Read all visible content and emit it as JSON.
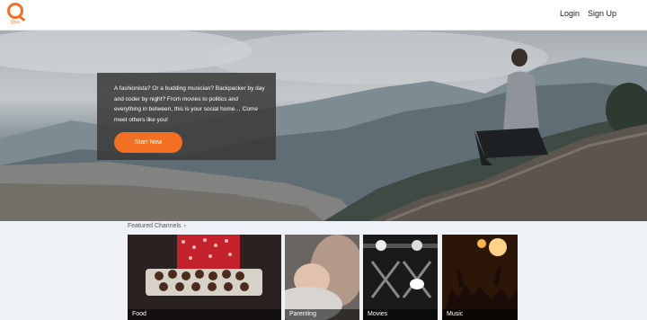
{
  "brand": {
    "logo_text": "Quu",
    "accent_color": "#f36f21"
  },
  "header": {
    "login_label": "Login",
    "signup_label": "Sign Up"
  },
  "hero": {
    "text": "A fashionista? Or a budding musician? Backpacker by day and coder by night? From movies to politics and everything in between, this is your social home… Come meet others like you!",
    "cta_label": "Start Now"
  },
  "featured": {
    "heading": "Featured Channels",
    "chevron_icon": "chevron-right-icon",
    "channels": [
      {
        "label": "Food"
      },
      {
        "label": "Parenting"
      },
      {
        "label": "Movies"
      },
      {
        "label": "Music"
      }
    ]
  }
}
